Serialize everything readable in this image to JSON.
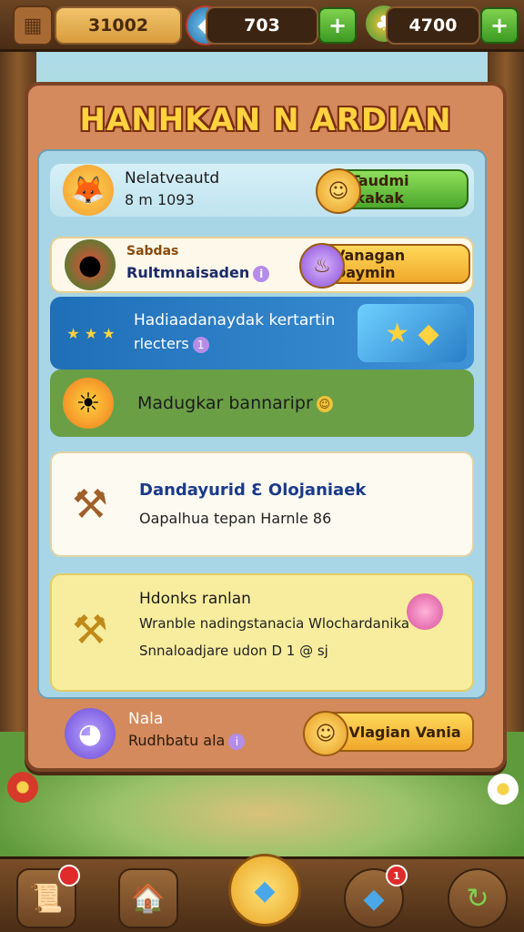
{
  "header": {
    "gold_value": "31002",
    "gem_value": "703",
    "coin_value": "4700",
    "plus_label": "+",
    "icons": {
      "gold": "crate-icon",
      "gem": "gem-icon",
      "coin": "clover-icon"
    }
  },
  "panel": {
    "title": "HANHKAN N ARDIAN",
    "rows": [
      {
        "title": "Nelatveautd",
        "subtitle": "8 m 1093",
        "button": "Taudmi ikakak",
        "icon": "fox-icon"
      },
      {
        "title": "Sabdas",
        "subtitle": "Rultmnaisaden",
        "button": "Vanagan Daymin",
        "icon": "watermelon-icon"
      },
      {
        "title": "Hadiaadanaydak kertartin",
        "subtitle": "rlecters",
        "icon": "star-ticket-icon",
        "tag": "1"
      },
      {
        "title": "Madugkar bannaripr",
        "icon": "sun-icon"
      },
      {
        "title": "Dandayurid  Ɛ Olojaniaek",
        "subtitle": "Oapalhua tepan Harnle 86",
        "icon": "hammer-icon"
      },
      {
        "title": "Hdonks ranlan",
        "line2": "Wranble nadingstanacia  Wlochardanika",
        "line3": "Snnaloadjare udon  D 1  @ sj",
        "icon": "hammer-gold-icon"
      }
    ],
    "footer": {
      "title": "Nala",
      "subtitle": "Rudhbatu ala",
      "button": "Vlagian Vania",
      "icon": "purple-creature-icon"
    }
  },
  "nav": {
    "items": [
      {
        "name": "scroll-icon",
        "badge": ""
      },
      {
        "name": "shop-icon",
        "badge": ""
      },
      {
        "name": "diamond-icon",
        "badge": ""
      },
      {
        "name": "shield-gem-icon",
        "badge": "1"
      },
      {
        "name": "refresh-icon",
        "badge": ""
      }
    ]
  },
  "colors": {
    "title": "#ffd23f",
    "accent_gold": "#f0a92b",
    "accent_green": "#4ba72b"
  }
}
